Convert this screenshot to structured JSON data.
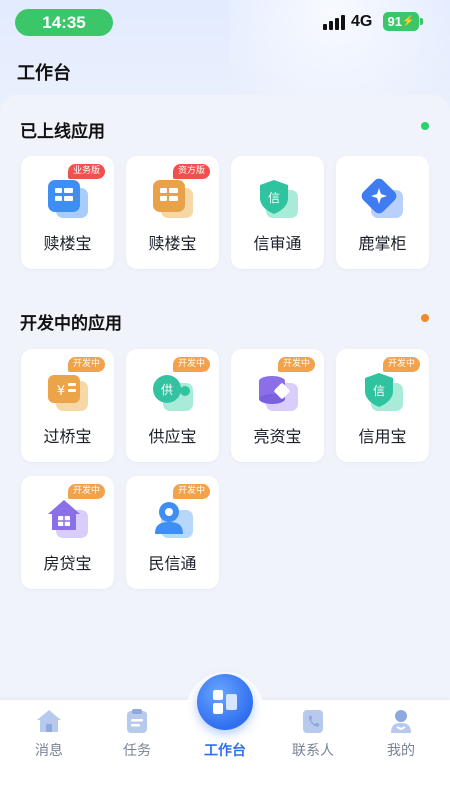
{
  "status_bar": {
    "time": "14:35",
    "network": "4G",
    "battery": "91"
  },
  "header": {
    "title": "工作台"
  },
  "sections": {
    "online": {
      "title": "已上线应用",
      "dot_color": "#2bd06b",
      "apps": [
        {
          "label": "赎楼宝",
          "badge": "业务版",
          "icon": "document-grid-icon",
          "color": "#3e8ff3"
        },
        {
          "label": "赎楼宝",
          "badge": "资方版",
          "icon": "document-grid-icon",
          "color": "#e8a24a"
        },
        {
          "label": "信审通",
          "badge": "",
          "icon": "shield-xin-icon",
          "color": "#2fc3a0"
        },
        {
          "label": "鹿掌柜",
          "badge": "",
          "icon": "diamond-star-icon",
          "color": "#3f7cf2"
        }
      ]
    },
    "developing": {
      "title": "开发中的应用",
      "dot_color": "#f08a2a",
      "apps": [
        {
          "label": "过桥宝",
          "badge": "开发中",
          "icon": "yen-card-icon",
          "color": "#eba548"
        },
        {
          "label": "供应宝",
          "badge": "开发中",
          "icon": "supply-gong-icon",
          "color": "#33c3a0"
        },
        {
          "label": "亮资宝",
          "badge": "开发中",
          "icon": "coin-stack-icon",
          "color": "#8a6fe8"
        },
        {
          "label": "信用宝",
          "badge": "开发中",
          "icon": "shield-xin-icon",
          "color": "#2fc3a0"
        },
        {
          "label": "房贷宝",
          "badge": "开发中",
          "icon": "house-icon",
          "color": "#8a6fe8"
        },
        {
          "label": "民信通",
          "badge": "开发中",
          "icon": "person-icon",
          "color": "#3e8ff3"
        }
      ]
    }
  },
  "tabbar": {
    "items": [
      {
        "label": "消息",
        "icon": "home-icon"
      },
      {
        "label": "任务",
        "icon": "clipboard-icon"
      },
      {
        "label": "工作台",
        "icon": "workbench-icon",
        "active": true
      },
      {
        "label": "联系人",
        "icon": "phone-book-icon"
      },
      {
        "label": "我的",
        "icon": "user-icon"
      }
    ],
    "active_color": "#2f6ff0",
    "inactive_color": "#7a8295"
  }
}
